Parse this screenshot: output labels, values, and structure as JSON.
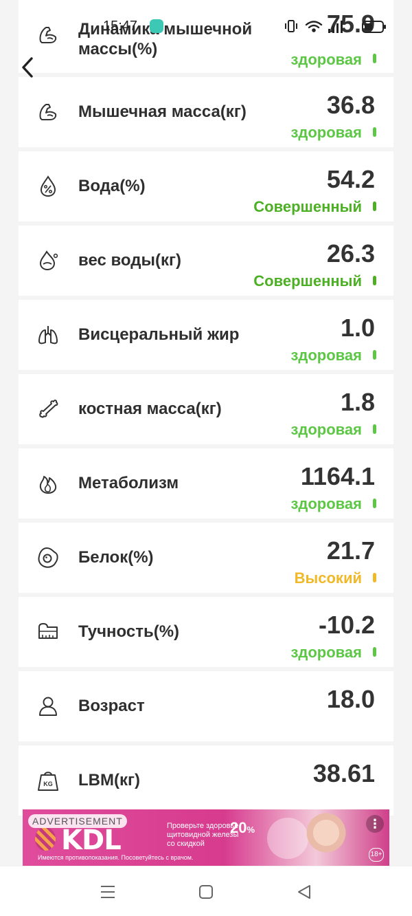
{
  "status_bar": {
    "time": "15:47"
  },
  "metrics": [
    {
      "icon": "muscle-icon",
      "label": "Динамика мышечной массы(%)",
      "value": "75.9",
      "status": "здоровая",
      "status_color": "#5cc744"
    },
    {
      "icon": "muscle-icon",
      "label": "Мышечная масса(кг)",
      "value": "36.8",
      "status": "здоровая",
      "status_color": "#5cc744"
    },
    {
      "icon": "water-drop-percent-icon",
      "label": "Вода(%)",
      "value": "54.2",
      "status": "Совершенный",
      "status_color": "#4caf24"
    },
    {
      "icon": "water-drop-icon",
      "label": "вес воды(кг)",
      "value": "26.3",
      "status": "Совершенный",
      "status_color": "#4caf24"
    },
    {
      "icon": "lungs-icon",
      "label": "Висцеральный жир",
      "value": "1.0",
      "status": "здоровая",
      "status_color": "#5cc744"
    },
    {
      "icon": "bone-icon",
      "label": "костная масса(кг)",
      "value": "1.8",
      "status": "здоровая",
      "status_color": "#5cc744"
    },
    {
      "icon": "flame-icon",
      "label": "Метаболизм",
      "value": "1164.1",
      "status": "здоровая",
      "status_color": "#5cc744"
    },
    {
      "icon": "egg-icon",
      "label": "Белок(%)",
      "value": "21.7",
      "status": "Высокий",
      "status_color": "#f0b92a"
    },
    {
      "icon": "tape-measure-icon",
      "label": "Тучность(%)",
      "value": "-10.2",
      "status": "здоровая",
      "status_color": "#5cc744"
    },
    {
      "icon": "person-icon",
      "label": "Возраст",
      "value": "18.0",
      "status": "",
      "status_color": ""
    },
    {
      "icon": "kg-weight-icon",
      "label": "LBM(кг)",
      "value": "38.61",
      "status": "",
      "status_color": ""
    }
  ],
  "ad": {
    "label": "ADVERTISEMENT",
    "brand": "KDL",
    "text": "Проверьте здоровье щитовидной железы со скидкой",
    "percent": "20",
    "percent_sign": "%",
    "disclaimer": "Имеются противопоказания. Посоветуйтесь с врачом.",
    "age": "18+"
  }
}
